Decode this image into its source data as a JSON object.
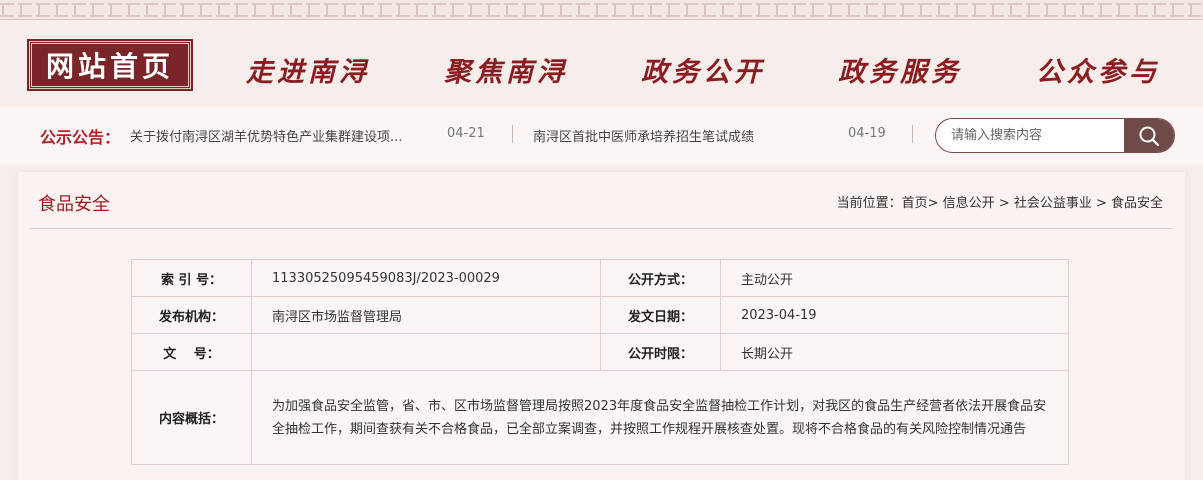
{
  "nav": {
    "home": "网站首页",
    "items": [
      "走进南浔",
      "聚焦南浔",
      "政务公开",
      "政务服务",
      "公众参与"
    ]
  },
  "notice": {
    "label": "公示公告：",
    "items": [
      {
        "title": "关于拨付南浔区湖羊优势特色产业集群建设项...",
        "date": "04-21"
      },
      {
        "title": "南浔区首批中医师承培养招生笔试成绩",
        "date": "04-19"
      }
    ]
  },
  "search": {
    "placeholder": "请输入搜索内容",
    "icon": "search-icon"
  },
  "page": {
    "title": "食品安全",
    "breadcrumb": "当前位置：首页> 信息公开 > 社会公益事业 > 食品安全"
  },
  "meta": {
    "index_label": "索 引 号：",
    "index_value": "11330525095459083J/2023-00029",
    "open_mode_label": "公开方式：",
    "open_mode_value": "主动公开",
    "org_label": "发布机构：",
    "org_value": "南浔区市场监督管理局",
    "date_label": "发文日期：",
    "date_value": "2023-04-19",
    "doc_no_label": "文　 号：",
    "doc_no_value": "",
    "period_label": "公开时限：",
    "period_value": "长期公开",
    "summary_label": "内容概括：",
    "summary_value": "为加强食品安全监管，省、市、区市场监督管理局按照2023年度食品安全监督抽检工作计划，对我区的食品生产经营者依法开展食品安全抽检工作，期间查获有关不合格食品，已全部立案调查，并按照工作规程开展核查处置。现将不合格食品的有关风险控制情况通告"
  },
  "colors": {
    "brand": "#8b1d21",
    "home_bg": "#7a2628",
    "search_btn": "#6e4a48"
  }
}
